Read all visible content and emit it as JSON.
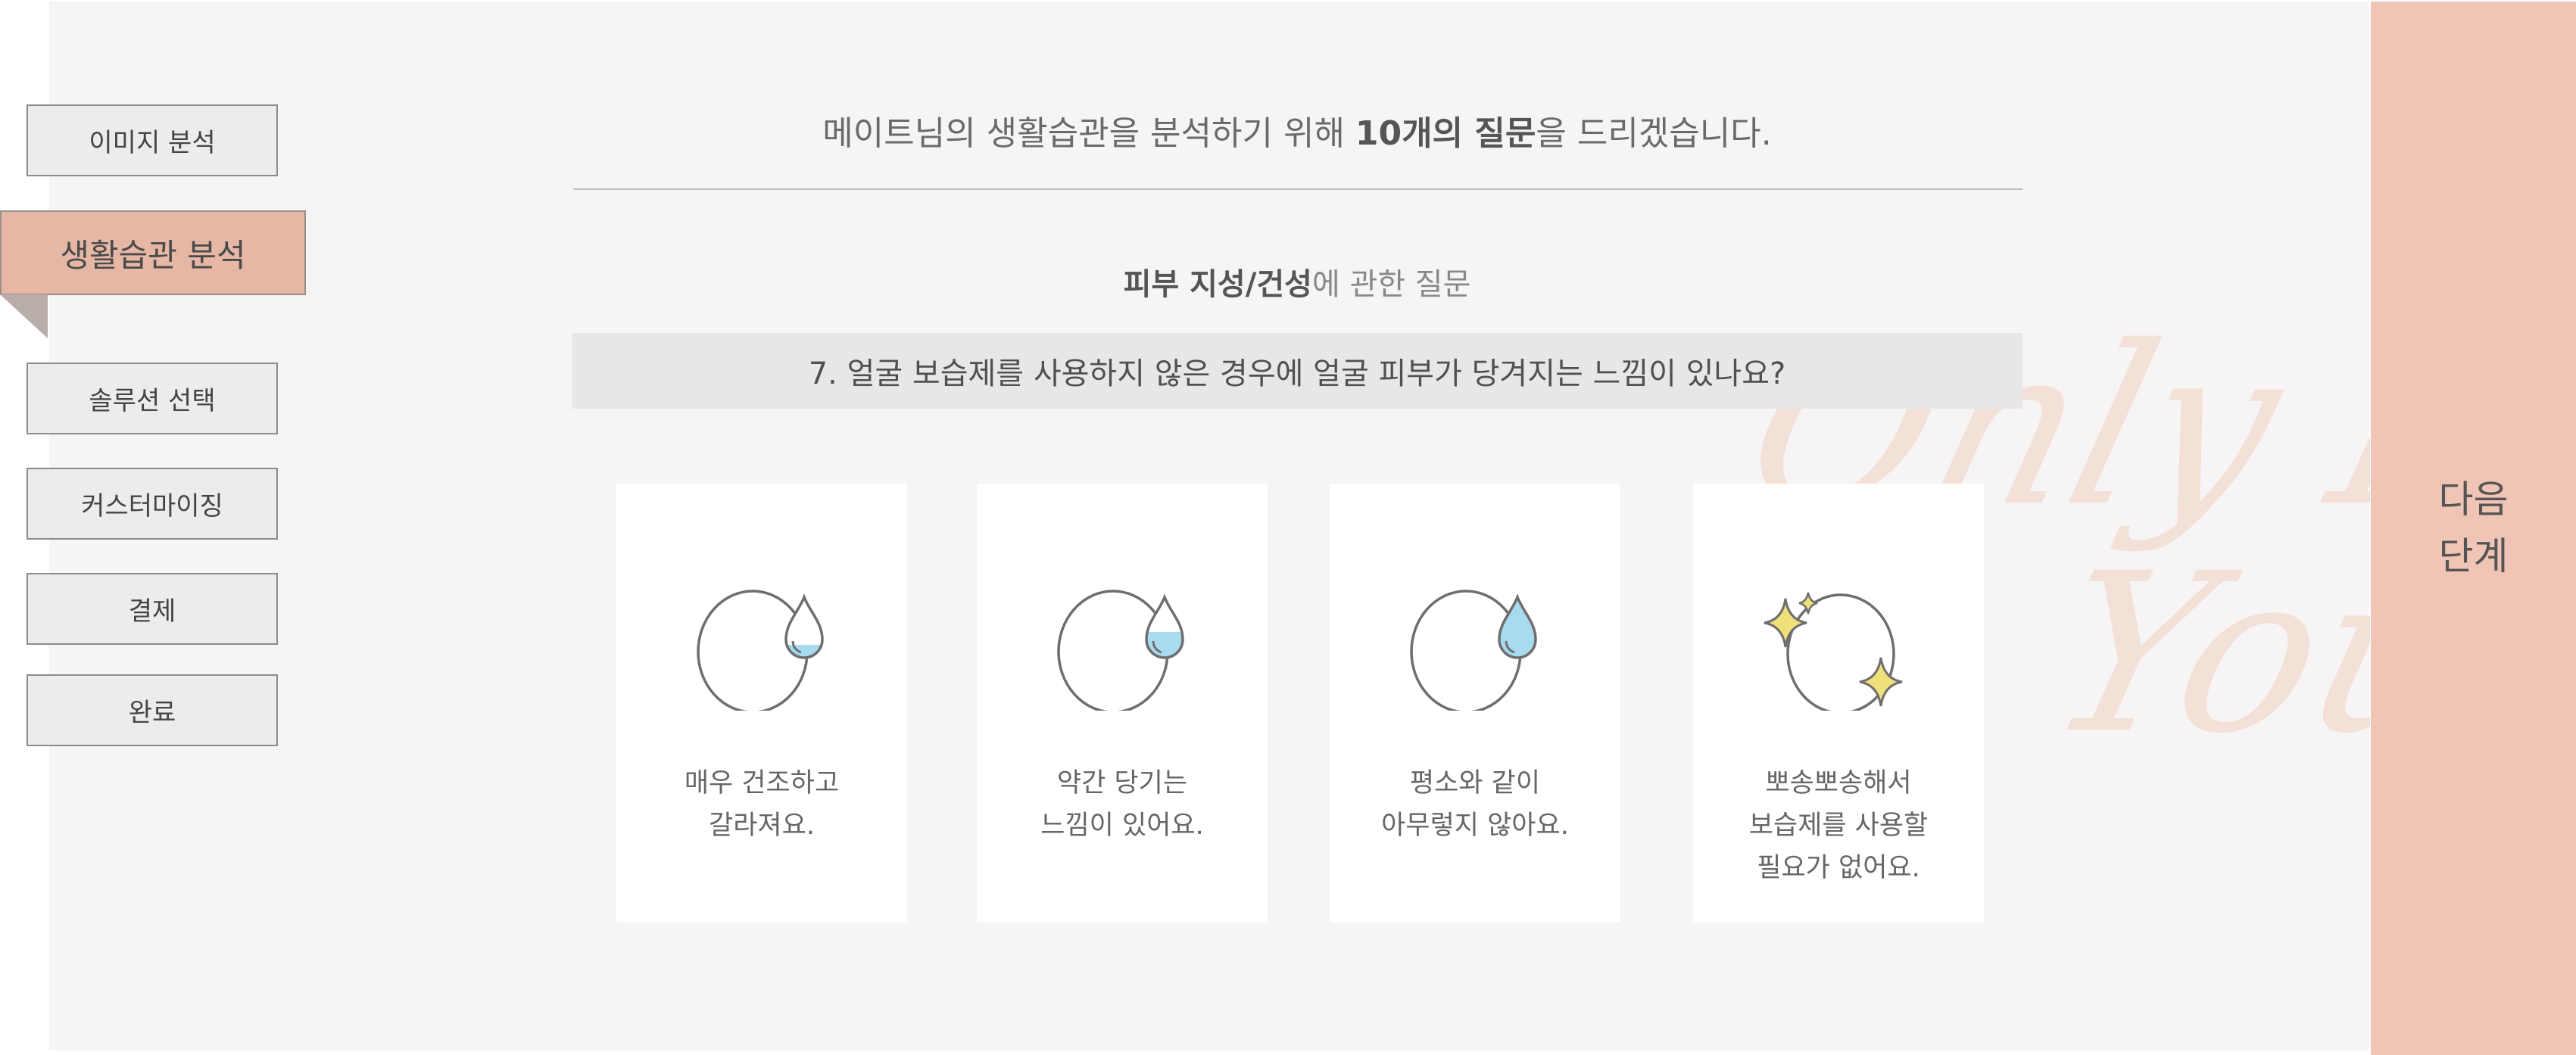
{
  "sidebar": {
    "items": [
      {
        "label": "이미지 분석",
        "active": false
      },
      {
        "label": "생활습관 분석",
        "active": true
      },
      {
        "label": "솔루션 선택",
        "active": false
      },
      {
        "label": "커스터마이징",
        "active": false
      },
      {
        "label": "결제",
        "active": false
      },
      {
        "label": "완료",
        "active": false
      }
    ]
  },
  "header": {
    "intro_pre": "메이트님의 생활습관을 분석하기 위해 ",
    "intro_bold": "10개의 질문",
    "intro_post": "을 드리겠습니다."
  },
  "section": {
    "topic_bold": "피부 지성/건성",
    "topic_rest": "에 관한 질문"
  },
  "question": {
    "text": "7. 얼굴 보습제를 사용하지 않은 경우에 얼굴 피부가 당겨지는 느낌이 있나요?"
  },
  "options": [
    {
      "line1": "매우 건조하고",
      "line2": "갈라져요.",
      "line3": "",
      "icon": "face-drop-low-icon"
    },
    {
      "line1": "약간 당기는",
      "line2": "느낌이 있어요.",
      "line3": "",
      "icon": "face-drop-half-icon"
    },
    {
      "line1": "평소와 같이",
      "line2": "아무렇지 않아요.",
      "line3": "",
      "icon": "face-drop-full-icon"
    },
    {
      "line1": "뽀송뽀송해서",
      "line2": "보습제를 사용할",
      "line3": "필요가 없어요.",
      "icon": "face-sparkle-icon"
    }
  ],
  "watermark": {
    "line1": "Only For",
    "line2": "You"
  },
  "next_button": {
    "line1": "다음",
    "line2": "단계"
  },
  "colors": {
    "accent": "#e6b7a5",
    "next_bg": "#f0c5b5",
    "water": "#a8daf0",
    "sparkle": "#f0e07a"
  }
}
